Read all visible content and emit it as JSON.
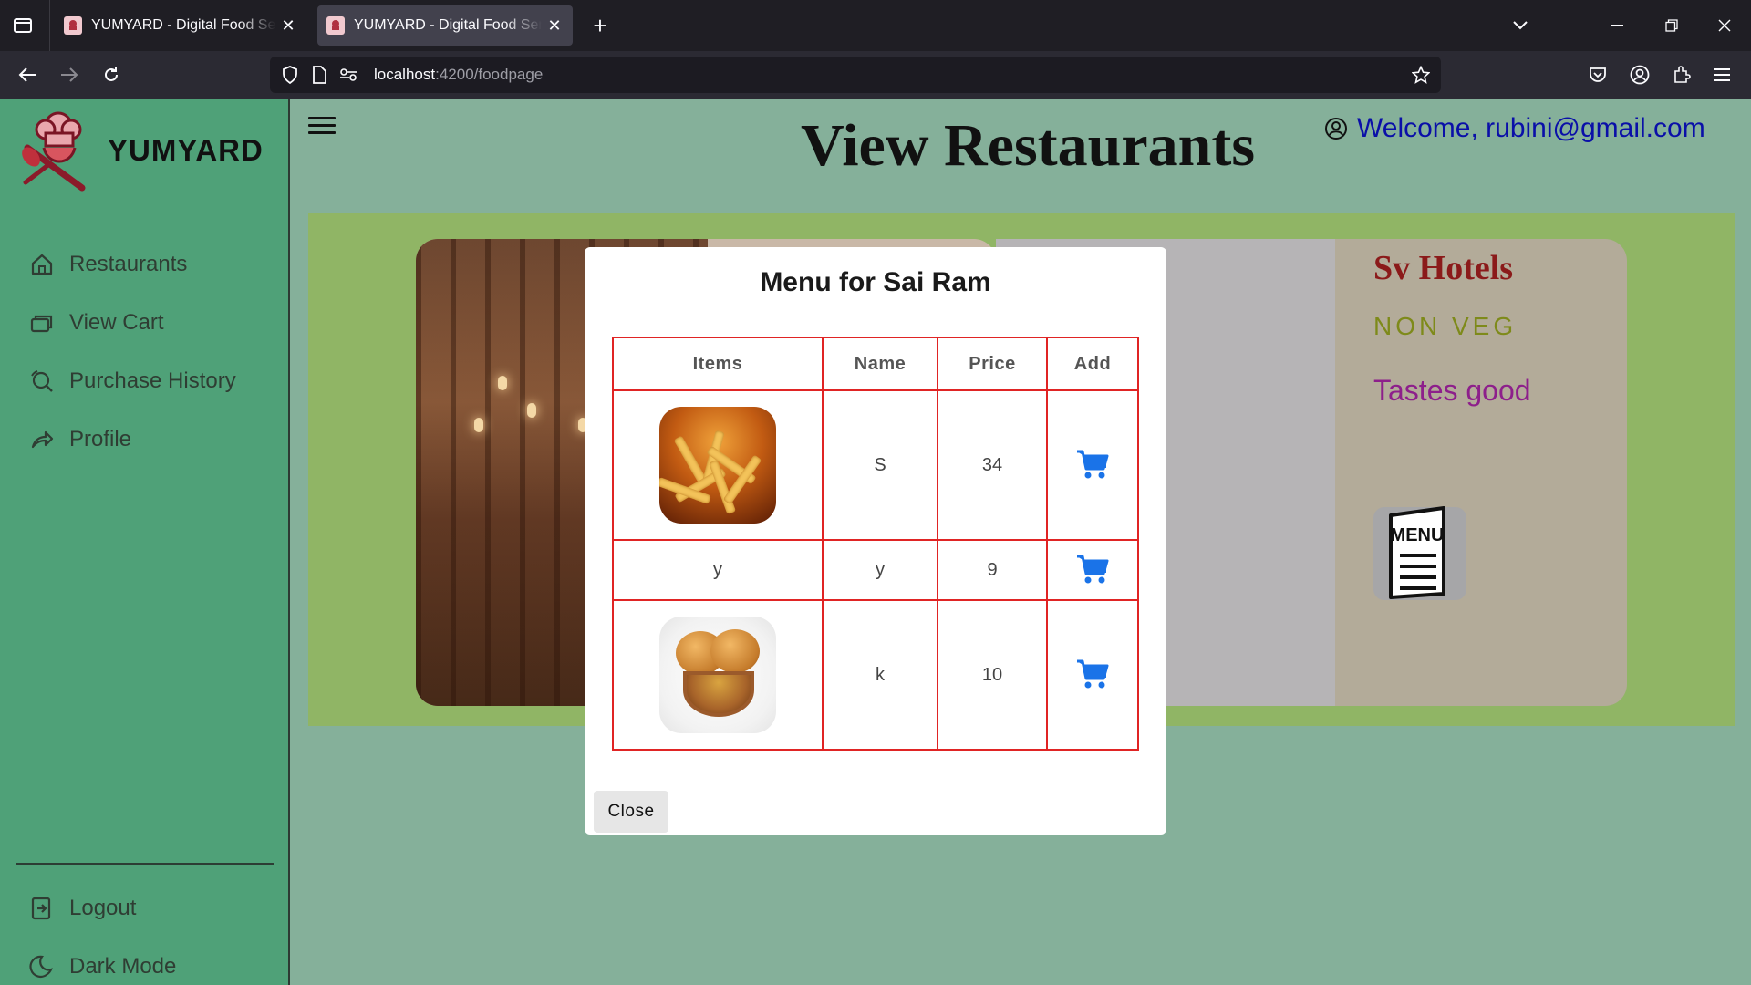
{
  "browser": {
    "tabs": [
      {
        "title": "YUMYARD - Digital Food Service",
        "active": false
      },
      {
        "title": "YUMYARD - Digital Food Service",
        "active": true
      }
    ],
    "url_host": "localhost",
    "url_path": ":4200/foodpage"
  },
  "sidebar": {
    "brand": "YUMYARD",
    "items": [
      {
        "label": "Restaurants",
        "icon": "home-icon"
      },
      {
        "label": "View Cart",
        "icon": "cart-stack-icon"
      },
      {
        "label": "Purchase History",
        "icon": "history-search-icon"
      },
      {
        "label": "Profile",
        "icon": "share-arrow-icon"
      }
    ],
    "bottom": [
      {
        "label": "Logout",
        "icon": "logout-icon"
      },
      {
        "label": "Dark Mode",
        "icon": "moon-icon"
      }
    ]
  },
  "header": {
    "title": "View Restaurants",
    "welcome": "Welcome, rubini@gmail.com"
  },
  "restaurants": [
    {
      "name": "Sai Ram"
    },
    {
      "name": "Sv Hotels",
      "type": "NON VEG",
      "description": "Tastes good"
    }
  ],
  "modal": {
    "title": "Menu for Sai Ram",
    "columns": [
      "Items",
      "Name",
      "Price",
      "Add"
    ],
    "rows": [
      {
        "item": "",
        "image": "french-fries",
        "name": "S",
        "price": "34"
      },
      {
        "item": "y",
        "image": "",
        "name": "y",
        "price": "9"
      },
      {
        "item": "",
        "image": "poori-curry",
        "name": "k",
        "price": "10"
      }
    ],
    "close_label": "Close"
  },
  "colors": {
    "page_bg": "#85b09a",
    "sidebar_bg": "#4fa178",
    "table_border": "#e02424",
    "cart_blue": "#1a73e8",
    "welcome_text": "#0a0fa8"
  }
}
